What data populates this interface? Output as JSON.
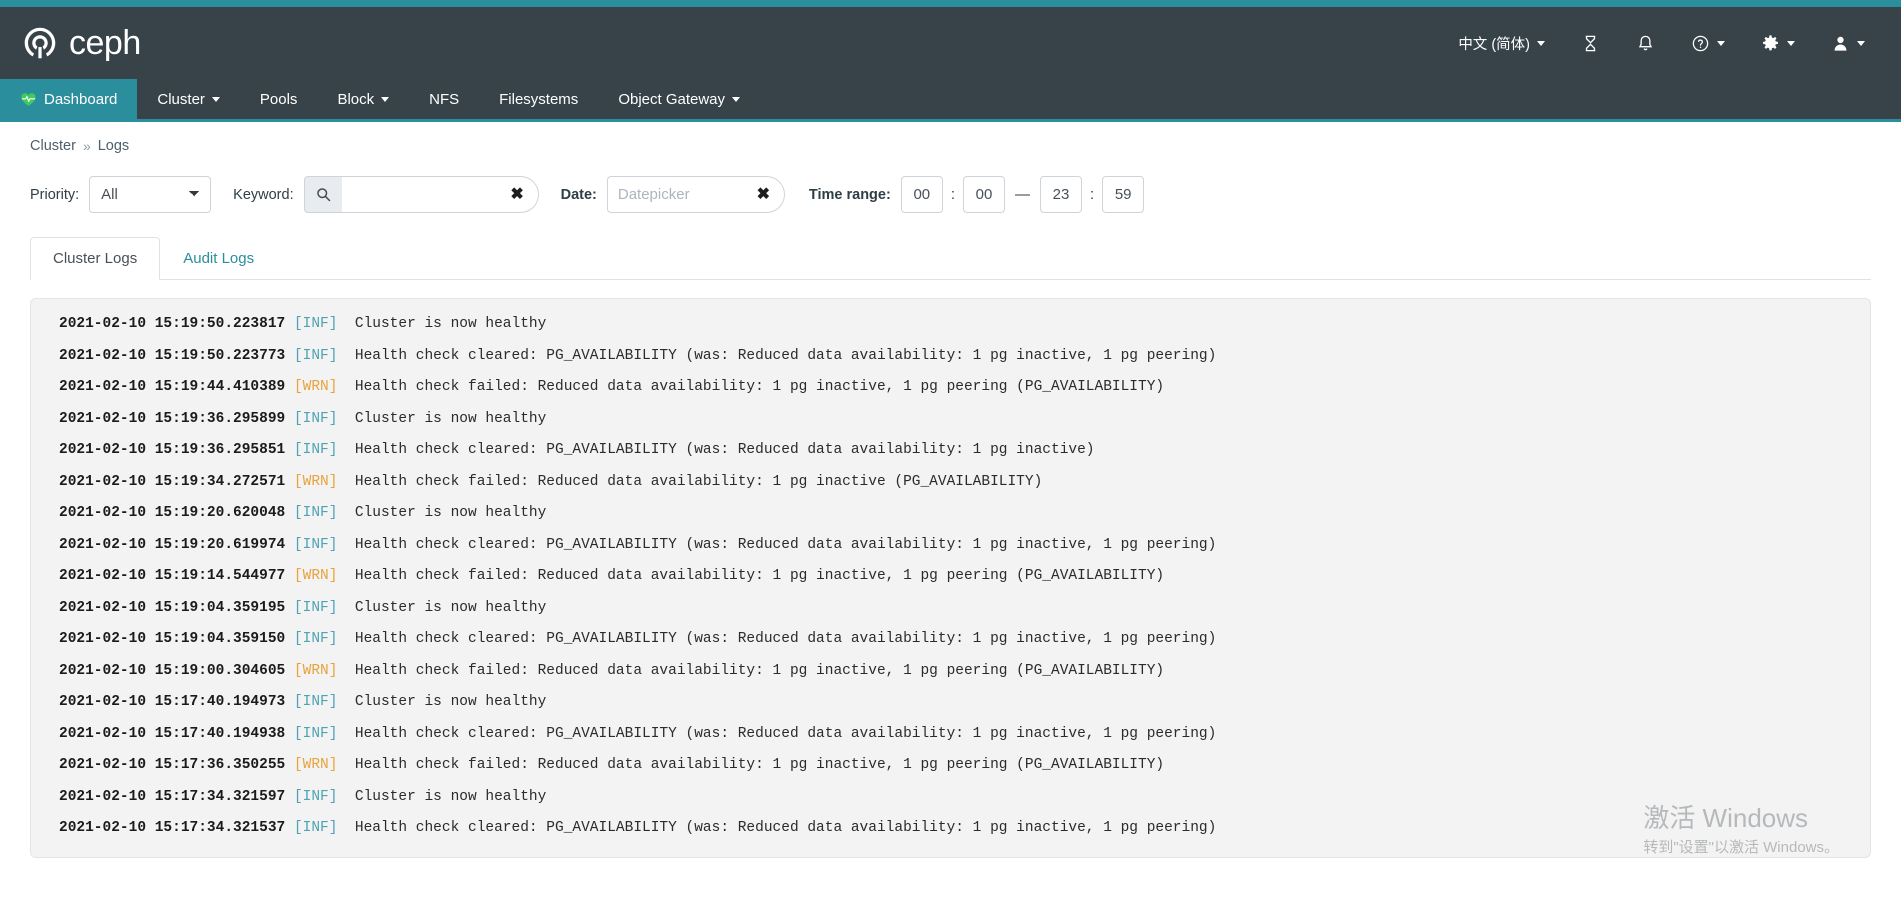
{
  "theme": {
    "header_bg": "#374349",
    "accent_teal": "#2b8e9c",
    "info_color": "#4da3b5",
    "warn_color": "#e8a33d",
    "panel_bg": "#f3f3f3"
  },
  "brand": {
    "name": "ceph",
    "logo_icon": "ceph-logo-icon"
  },
  "identity_bar": {
    "language": {
      "label": "中文 (简体)",
      "icon": "chevron-down-icon"
    },
    "tasks": {
      "icon": "hourglass-icon"
    },
    "notifications": {
      "icon": "bell-icon"
    },
    "help": {
      "icon": "question-circle-icon"
    },
    "settings": {
      "icon": "gear-icon"
    },
    "user": {
      "icon": "user-icon"
    }
  },
  "main_nav": {
    "items": [
      {
        "label": "Dashboard",
        "icon": "heartbeat-icon",
        "active": true,
        "has_caret": false
      },
      {
        "label": "Cluster",
        "active": false,
        "has_caret": true
      },
      {
        "label": "Pools",
        "active": false,
        "has_caret": false
      },
      {
        "label": "Block",
        "active": false,
        "has_caret": true
      },
      {
        "label": "NFS",
        "active": false,
        "has_caret": false
      },
      {
        "label": "Filesystems",
        "active": false,
        "has_caret": false
      },
      {
        "label": "Object Gateway",
        "active": false,
        "has_caret": true
      }
    ]
  },
  "breadcrumb": {
    "parent": "Cluster",
    "separator": "»",
    "current": "Logs"
  },
  "filters": {
    "priority_label": "Priority:",
    "priority_value": "All",
    "priority_options": [
      "All"
    ],
    "keyword_label": "Keyword:",
    "keyword_value": "",
    "keyword_placeholder": "",
    "search_icon": "search-icon",
    "keyword_clear_icon": "clear-x-icon",
    "date_label": "Date:",
    "date_value": "",
    "date_placeholder": "Datepicker",
    "date_clear_icon": "clear-x-icon",
    "time_range_label": "Time range:",
    "start_hour": "00",
    "start_minute": "00",
    "end_hour": "23",
    "end_minute": "59",
    "colon": ":",
    "dash": "—"
  },
  "tabs": [
    {
      "label": "Cluster Logs",
      "active": true
    },
    {
      "label": "Audit Logs",
      "active": false
    }
  ],
  "logs": [
    {
      "ts": "2021-02-10 15:19:50.223817",
      "level": "INF",
      "msg": "Cluster is now healthy"
    },
    {
      "ts": "2021-02-10 15:19:50.223773",
      "level": "INF",
      "msg": "Health check cleared: PG_AVAILABILITY (was: Reduced data availability: 1 pg inactive, 1 pg peering)"
    },
    {
      "ts": "2021-02-10 15:19:44.410389",
      "level": "WRN",
      "msg": "Health check failed: Reduced data availability: 1 pg inactive, 1 pg peering (PG_AVAILABILITY)"
    },
    {
      "ts": "2021-02-10 15:19:36.295899",
      "level": "INF",
      "msg": "Cluster is now healthy"
    },
    {
      "ts": "2021-02-10 15:19:36.295851",
      "level": "INF",
      "msg": "Health check cleared: PG_AVAILABILITY (was: Reduced data availability: 1 pg inactive)"
    },
    {
      "ts": "2021-02-10 15:19:34.272571",
      "level": "WRN",
      "msg": "Health check failed: Reduced data availability: 1 pg inactive (PG_AVAILABILITY)"
    },
    {
      "ts": "2021-02-10 15:19:20.620048",
      "level": "INF",
      "msg": "Cluster is now healthy"
    },
    {
      "ts": "2021-02-10 15:19:20.619974",
      "level": "INF",
      "msg": "Health check cleared: PG_AVAILABILITY (was: Reduced data availability: 1 pg inactive, 1 pg peering)"
    },
    {
      "ts": "2021-02-10 15:19:14.544977",
      "level": "WRN",
      "msg": "Health check failed: Reduced data availability: 1 pg inactive, 1 pg peering (PG_AVAILABILITY)"
    },
    {
      "ts": "2021-02-10 15:19:04.359195",
      "level": "INF",
      "msg": "Cluster is now healthy"
    },
    {
      "ts": "2021-02-10 15:19:04.359150",
      "level": "INF",
      "msg": "Health check cleared: PG_AVAILABILITY (was: Reduced data availability: 1 pg inactive, 1 pg peering)"
    },
    {
      "ts": "2021-02-10 15:19:00.304605",
      "level": "WRN",
      "msg": "Health check failed: Reduced data availability: 1 pg inactive, 1 pg peering (PG_AVAILABILITY)"
    },
    {
      "ts": "2021-02-10 15:17:40.194973",
      "level": "INF",
      "msg": "Cluster is now healthy"
    },
    {
      "ts": "2021-02-10 15:17:40.194938",
      "level": "INF",
      "msg": "Health check cleared: PG_AVAILABILITY (was: Reduced data availability: 1 pg inactive, 1 pg peering)"
    },
    {
      "ts": "2021-02-10 15:17:36.350255",
      "level": "WRN",
      "msg": "Health check failed: Reduced data availability: 1 pg inactive, 1 pg peering (PG_AVAILABILITY)"
    },
    {
      "ts": "2021-02-10 15:17:34.321597",
      "level": "INF",
      "msg": "Cluster is now healthy"
    },
    {
      "ts": "2021-02-10 15:17:34.321537",
      "level": "INF",
      "msg": "Health check cleared: PG_AVAILABILITY (was: Reduced data availability: 1 pg inactive, 1 pg peering)"
    }
  ],
  "watermark": {
    "title": "激活 Windows",
    "subtitle": "转到\"设置\"以激活 Windows。"
  }
}
